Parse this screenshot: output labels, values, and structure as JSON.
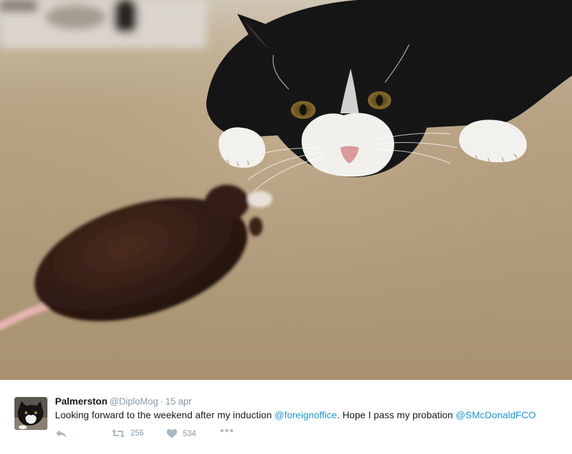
{
  "photo": {
    "subject": "tuxedo cat watching a knitted toy mouse",
    "icons": [
      "cat-icon",
      "toy-mouse-icon"
    ]
  },
  "tweet": {
    "author_name": "Palmerston",
    "author_handle": "@DiploMog",
    "separator": "·",
    "date": "15 apr",
    "text_before": "Looking forward to the weekend after my induction ",
    "mention_1": "@foreignoffice",
    "text_middle": ". Hope I pass my probation ",
    "mention_2": "@SMcDonaldFCO",
    "retweet_count": "256",
    "like_count": "534",
    "icons": {
      "reply": "reply-icon",
      "retweet": "retweet-icon",
      "like": "heart-icon",
      "more": "more-dots-icon"
    }
  },
  "colors": {
    "mention": "#1b95e0",
    "muted": "#8899a6",
    "icon": "#aab8c2",
    "text": "#14171a"
  }
}
